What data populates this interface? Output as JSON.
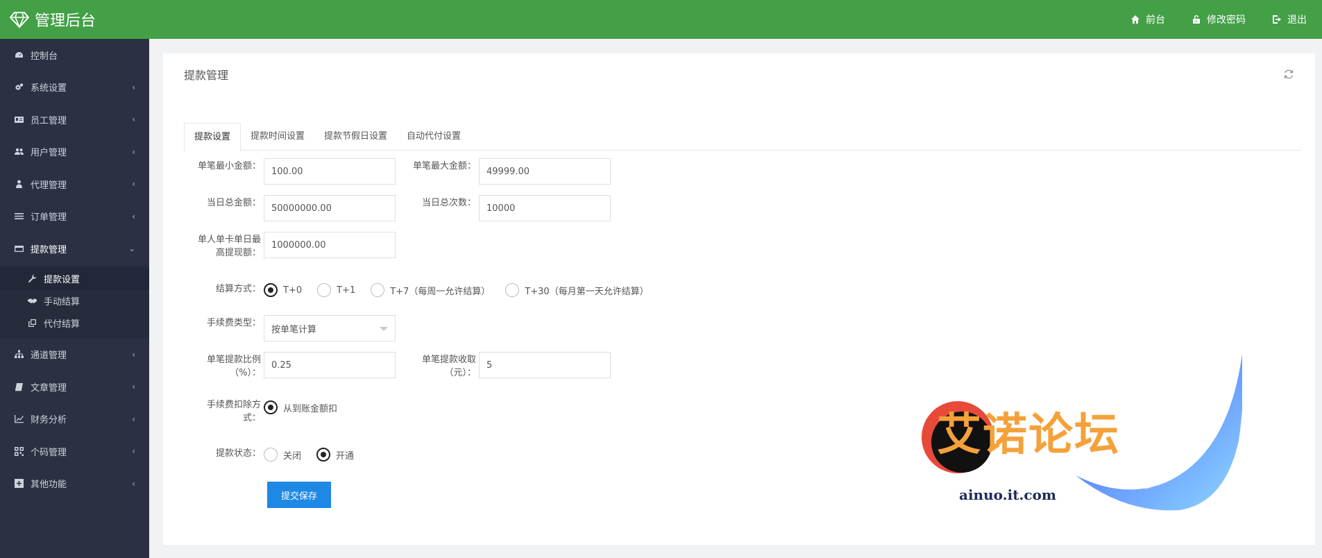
{
  "header": {
    "title": "管理后台",
    "links": [
      {
        "label": "前台",
        "icon": "home-icon"
      },
      {
        "label": "修改密码",
        "icon": "unlock-icon"
      },
      {
        "label": "退出",
        "icon": "logout-icon"
      }
    ]
  },
  "sidebar": {
    "items": [
      {
        "label": "控制台",
        "icon": "dashboard-icon",
        "chevron": ""
      },
      {
        "label": "系统设置",
        "icon": "gears-icon",
        "chevron": "‹"
      },
      {
        "label": "员工管理",
        "icon": "id-card-icon",
        "chevron": "‹"
      },
      {
        "label": "用户管理",
        "icon": "users-icon",
        "chevron": "‹"
      },
      {
        "label": "代理管理",
        "icon": "user-tie-icon",
        "chevron": "‹"
      },
      {
        "label": "订单管理",
        "icon": "list-icon",
        "chevron": "‹"
      },
      {
        "label": "提款管理",
        "icon": "credit-card-icon",
        "chevron": "⌄"
      },
      {
        "label": "通道管理",
        "icon": "sitemap-icon",
        "chevron": "‹"
      },
      {
        "label": "文章管理",
        "icon": "book-icon",
        "chevron": "‹"
      },
      {
        "label": "财务分析",
        "icon": "line-chart-icon",
        "chevron": "‹"
      },
      {
        "label": "个码管理",
        "icon": "qrcode-icon",
        "chevron": "‹"
      },
      {
        "label": "其他功能",
        "icon": "plus-square-icon",
        "chevron": "‹"
      }
    ],
    "sub_items": [
      {
        "label": "提款设置",
        "icon": "wrench-icon"
      },
      {
        "label": "手动结算",
        "icon": "handshake-icon"
      },
      {
        "label": "代付结算",
        "icon": "clone-icon"
      }
    ]
  },
  "panel": {
    "title": "提款管理",
    "tabs": [
      "提款设置",
      "提款时间设置",
      "提款节假日设置",
      "自动代付设置"
    ],
    "active_tab": 0
  },
  "form": {
    "min_amount": {
      "label": "单笔最小金额：",
      "value": "100.00"
    },
    "max_amount": {
      "label": "单笔最大金额：",
      "value": "49999.00"
    },
    "daily_total": {
      "label": "当日总金额：",
      "value": "50000000.00"
    },
    "daily_count": {
      "label": "当日总次数：",
      "value": "10000"
    },
    "card_daily_max": {
      "label_line1": "单人单卡单日最",
      "label_line2": "高提现额：",
      "value": "1000000.00"
    },
    "settle_mode": {
      "label": "结算方式：",
      "options": [
        "T+0",
        "T+1",
        "T+7（每周一允许结算）",
        "T+30（每月第一天允许结算）"
      ],
      "selected": 0
    },
    "fee_type": {
      "label": "手续费类型：",
      "value": "按单笔计算"
    },
    "fee_rate": {
      "label_line1": "单笔提款比例",
      "label_line2": "（%）：",
      "value": "0.25"
    },
    "fee_fixed": {
      "label_line1": "单笔提款收取",
      "label_line2": "（元）：",
      "value": "5"
    },
    "fee_deduct": {
      "label_line1": "手续费扣除方",
      "label_line2": "式：",
      "options": [
        "从到账金额扣"
      ],
      "selected": 0
    },
    "status": {
      "label": "提款状态：",
      "options": [
        "关闭",
        "开通"
      ],
      "selected": 1
    },
    "submit_label": "提交保存"
  },
  "watermark": {
    "text": "艾诺论坛",
    "url": "ainuo.it.com"
  },
  "colors": {
    "header": "#43a047",
    "sidebar": "#2b3142",
    "primary": "#1e88e5"
  }
}
